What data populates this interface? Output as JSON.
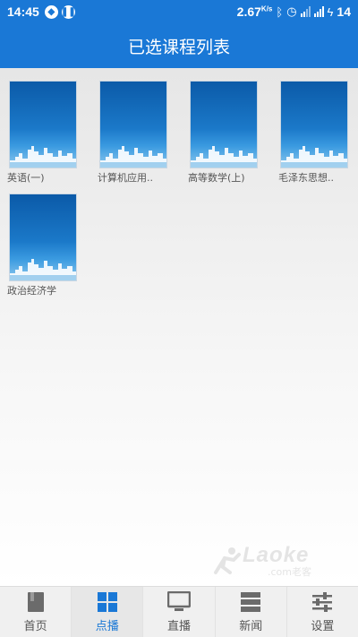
{
  "status_bar": {
    "time": "14:45",
    "net_speed": "2.67",
    "net_unit": "K/s",
    "battery": "14",
    "icons": [
      "notification-icon",
      "pause-icon",
      "bluetooth-icon",
      "alarm-icon",
      "4g-signal-icon",
      "signal-icon",
      "charging-icon"
    ]
  },
  "header": {
    "title": "已选课程列表"
  },
  "courses": [
    {
      "label": "英语(一)"
    },
    {
      "label": "计算机应用.."
    },
    {
      "label": "高等数学(上)"
    },
    {
      "label": "毛泽东思想.."
    },
    {
      "label": "政治经济学"
    }
  ],
  "watermark": {
    "brand": "Laoke",
    "sub": ".com老客"
  },
  "nav": {
    "items": [
      {
        "label": "首页",
        "icon": "book-icon"
      },
      {
        "label": "点播",
        "icon": "grid-icon",
        "active": true
      },
      {
        "label": "直播",
        "icon": "monitor-icon"
      },
      {
        "label": "新闻",
        "icon": "server-list-icon"
      },
      {
        "label": "设置",
        "icon": "sliders-icon"
      }
    ]
  },
  "colors": {
    "accent": "#1a78d6",
    "nav_bg": "#f0f0f0",
    "inactive": "#555555"
  }
}
